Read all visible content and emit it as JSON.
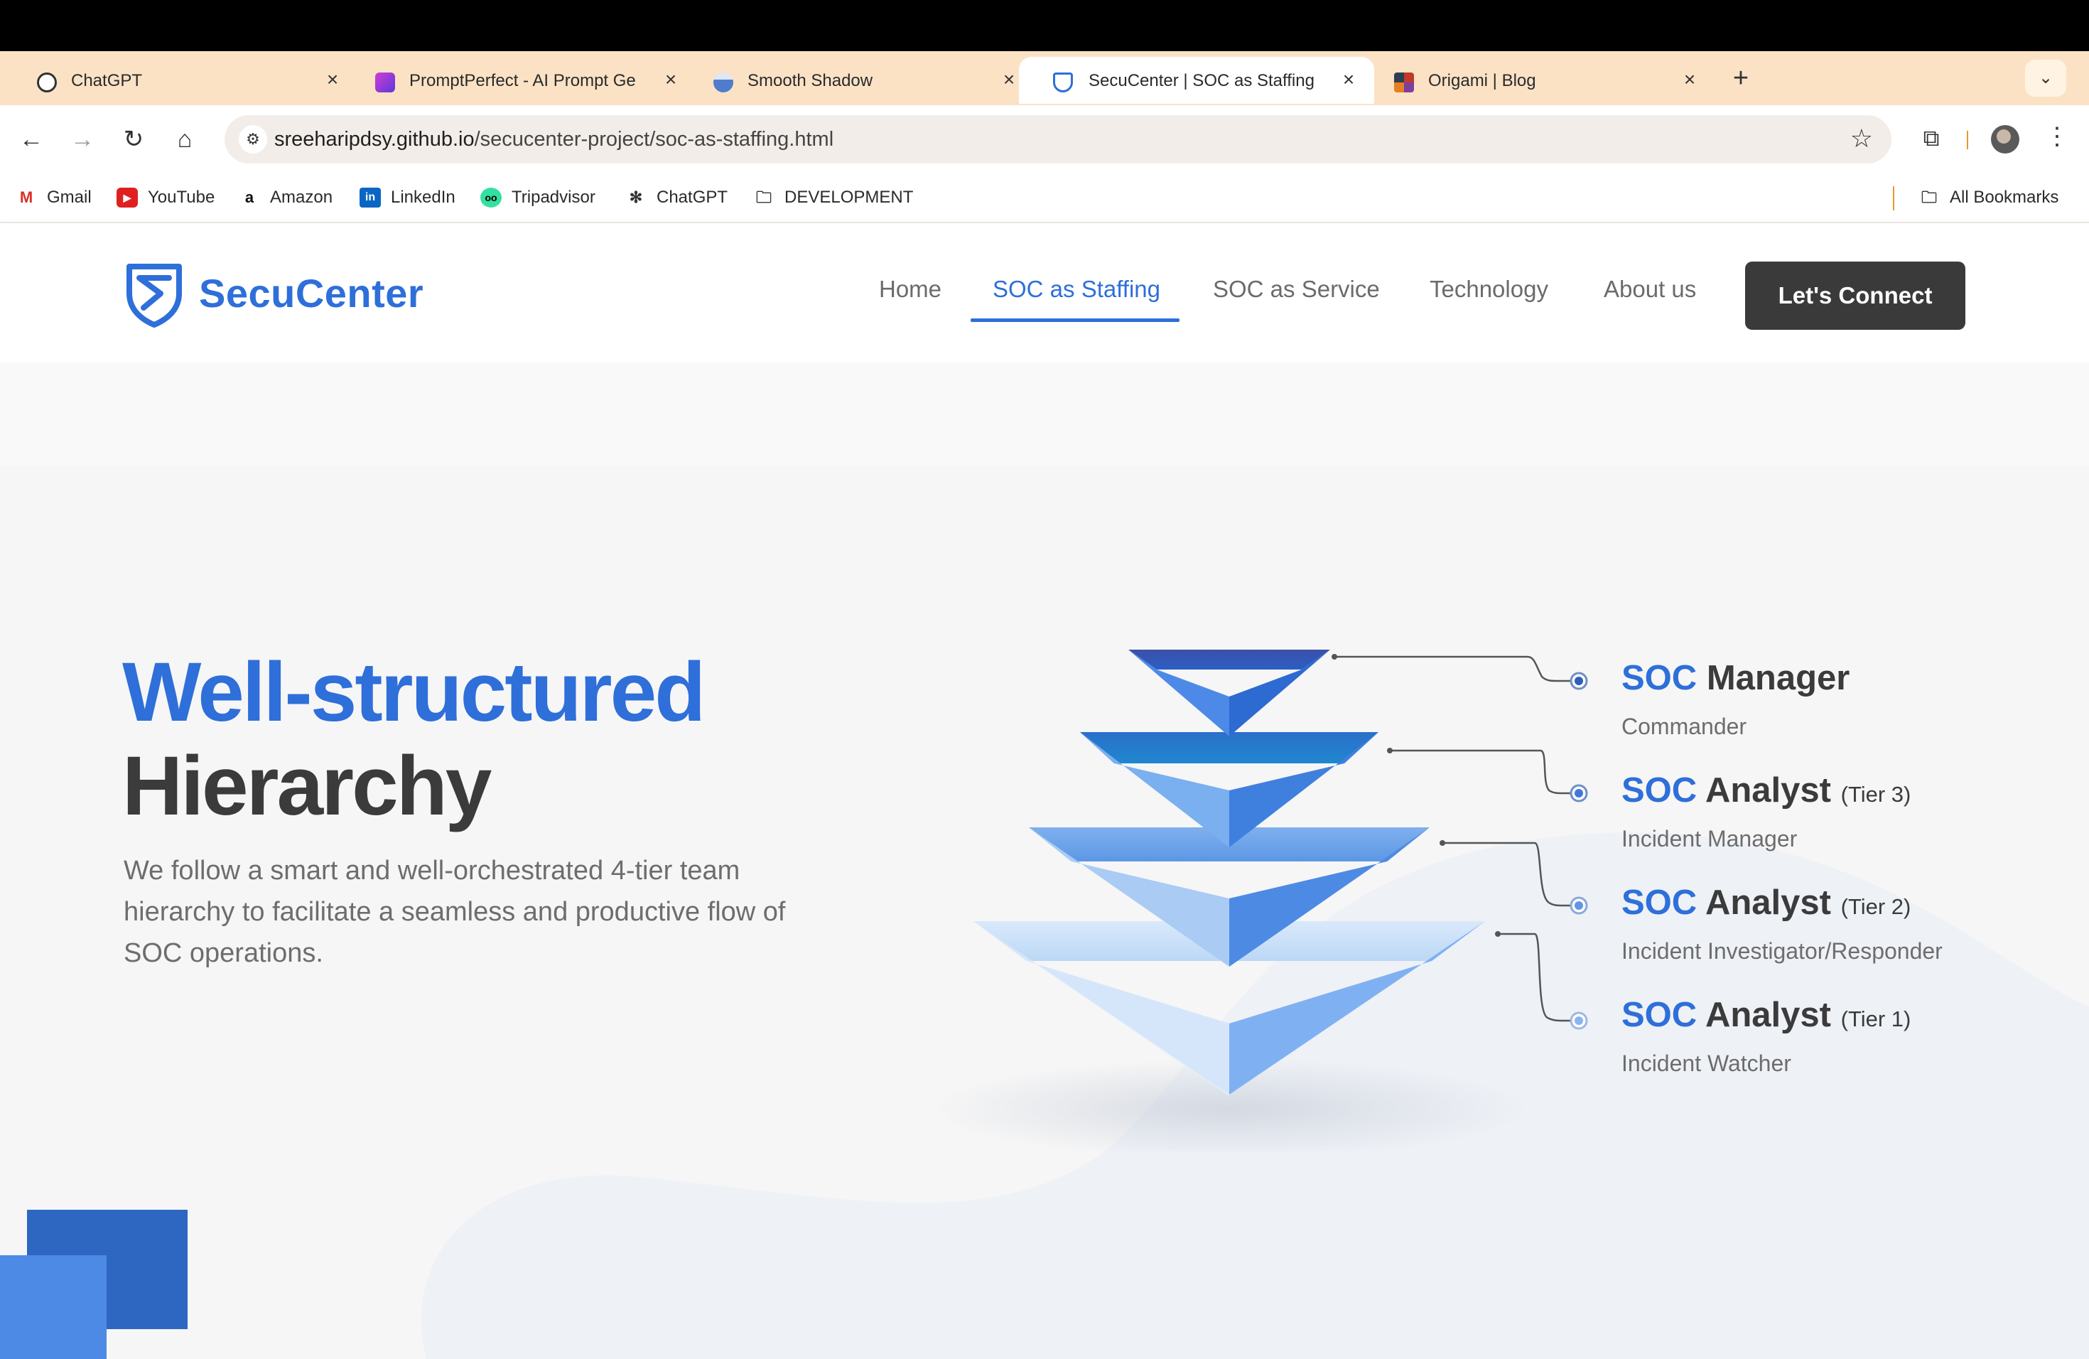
{
  "browser": {
    "tabs": [
      {
        "title": "ChatGPT",
        "icon": "openai-icon",
        "active": false
      },
      {
        "title": "PromptPerfect - AI Prompt Ge",
        "icon": "promptperfect-icon",
        "active": false
      },
      {
        "title": "Smooth Shadow",
        "icon": "smooth-shadow-icon",
        "active": false
      },
      {
        "title": "SecuCenter | SOC as Staffing",
        "icon": "shield-icon",
        "active": true
      },
      {
        "title": "Origami | Blog",
        "icon": "origami-icon",
        "active": false
      }
    ],
    "url_host": "sreeharipdsy.github.io",
    "url_path": "/secucenter-project/soc-as-staffing.html",
    "bookmarks": [
      {
        "label": "Gmail",
        "icon": "gmail-icon"
      },
      {
        "label": "YouTube",
        "icon": "youtube-icon"
      },
      {
        "label": "Amazon",
        "icon": "amazon-icon"
      },
      {
        "label": "LinkedIn",
        "icon": "linkedin-icon"
      },
      {
        "label": "Tripadvisor",
        "icon": "tripadvisor-icon"
      },
      {
        "label": "ChatGPT",
        "icon": "openai-icon"
      },
      {
        "label": "DEVELOPMENT",
        "icon": "folder-icon"
      }
    ],
    "all_bookmarks": "All Bookmarks"
  },
  "site": {
    "logo_text": "SecuCenter",
    "nav": [
      {
        "label": "Home",
        "active": false
      },
      {
        "label": "SOC as Staffing",
        "active": true
      },
      {
        "label": "SOC as Service",
        "active": false
      },
      {
        "label": "Technology",
        "active": false
      },
      {
        "label": "About us",
        "active": false
      }
    ],
    "cta_label": "Let's Connect"
  },
  "hero": {
    "title_line1": "Well-structured",
    "title_line2": "Hierarchy",
    "description": "We follow a smart and well-orchestrated 4-tier team hierarchy to facilitate a seamless and productive flow of SOC operations."
  },
  "tiers": [
    {
      "prefix": "SOC",
      "role": "Manager",
      "tier": "",
      "desc": "Commander"
    },
    {
      "prefix": "SOC",
      "role": "Analyst",
      "tier": "(Tier 3)",
      "desc": "Incident Manager"
    },
    {
      "prefix": "SOC",
      "role": "Analyst",
      "tier": "(Tier 2)",
      "desc": "Incident Investigator/Responder"
    },
    {
      "prefix": "SOC",
      "role": "Analyst",
      "tier": "(Tier 1)",
      "desc": "Incident Watcher"
    }
  ],
  "colors": {
    "brand_blue": "#2e6fd9",
    "dark": "#3a3a3a",
    "tab_strip": "#fbe2c5"
  }
}
